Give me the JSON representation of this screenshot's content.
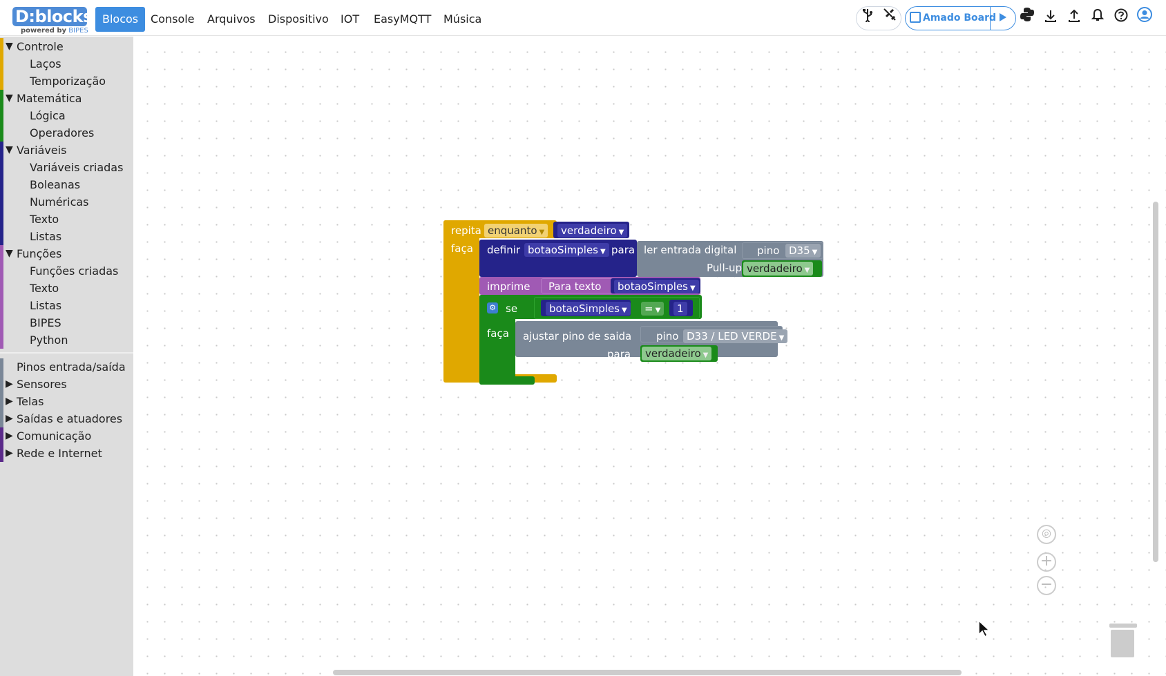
{
  "app": {
    "logo": "D:blocks",
    "logo_sub_prefix": "powered by",
    "logo_sub_brand": "BIPES"
  },
  "nav": {
    "tabs": [
      "Blocos",
      "Console",
      "Arquivos",
      "Dispositivo",
      "IOT",
      "EasyMQTT",
      "Música"
    ],
    "active": "Blocos"
  },
  "toolbar": {
    "board_label": "Amado Board",
    "icons": [
      "usb-icon",
      "disconnect-icon",
      "board-icon",
      "run-icon",
      "python-icon",
      "download-icon",
      "upload-icon",
      "bell-icon",
      "help-icon",
      "account-icon"
    ]
  },
  "sidebar": {
    "items": [
      {
        "label": "Controle",
        "level": 0,
        "arrow": "▼",
        "color": "#e0a800"
      },
      {
        "label": "Laços",
        "level": 1,
        "color": "#e0a800"
      },
      {
        "label": "Temporização",
        "level": 1,
        "color": "#e0a800"
      },
      {
        "label": "Matemática",
        "level": 0,
        "arrow": "▼",
        "color": "#1a8a1a"
      },
      {
        "label": "Lógica",
        "level": 1,
        "color": "#1a8a1a"
      },
      {
        "label": "Operadores",
        "level": 1,
        "color": "#1a8a1a"
      },
      {
        "label": "Variáveis",
        "level": 0,
        "arrow": "▼",
        "color": "#25238a"
      },
      {
        "label": "Variáveis criadas",
        "level": 1,
        "color": "#25238a"
      },
      {
        "label": "Boleanas",
        "level": 1,
        "color": "#25238a"
      },
      {
        "label": "Numéricas",
        "level": 1,
        "color": "#25238a"
      },
      {
        "label": "Texto",
        "level": 1,
        "color": "#25238a"
      },
      {
        "label": "Listas",
        "level": 1,
        "color": "#25238a"
      },
      {
        "label": "Funções",
        "level": 0,
        "arrow": "▼",
        "color": "#a05ab4"
      },
      {
        "label": "Funções criadas",
        "level": 1,
        "color": "#a05ab4"
      },
      {
        "label": "Texto",
        "level": 1,
        "color": "#a05ab4"
      },
      {
        "label": "Listas",
        "level": 1,
        "color": "#a05ab4"
      },
      {
        "label": "BIPES",
        "level": 1,
        "color": "#a05ab4"
      },
      {
        "label": "Python",
        "level": 1,
        "color": "#a05ab4"
      },
      {
        "label": "Pinos entrada/saída",
        "level": 0,
        "arrow": "",
        "color": "#7a8797"
      },
      {
        "label": "Sensores",
        "level": 0,
        "arrow": "▶",
        "color": "#7a8797"
      },
      {
        "label": "Telas",
        "level": 0,
        "arrow": "▶",
        "color": "#7a8797"
      },
      {
        "label": "Saídas e atuadores",
        "level": 0,
        "arrow": "▶",
        "color": "#7a8797"
      },
      {
        "label": "Comunicação",
        "level": 0,
        "arrow": "▶",
        "color": "#5b2a8a"
      },
      {
        "label": "Rede e Internet",
        "level": 0,
        "arrow": "▶",
        "color": "#5b2a8a"
      }
    ]
  },
  "blocks": {
    "repeat_kw": "repita",
    "repeat_mode": "enquanto",
    "repeat_cond": "verdadeiro",
    "repeat_do": "faça",
    "set_kw": "definir",
    "set_var": "botaoSimples",
    "set_to": "para",
    "digital_in": "ler entrada digital",
    "pin_kw": "pino",
    "pin_in": "D35",
    "pullup": "Pull-up",
    "pullup_val": "verdadeiro",
    "print_kw": "imprime",
    "to_text": "Para texto",
    "print_var": "botaoSimples",
    "if_kw": "se",
    "cmp_var": "botaoSimples",
    "cmp_op": "=",
    "cmp_num": "1",
    "if_do": "faça",
    "set_pin": "ajustar pino de saida",
    "pin_kw2": "pino",
    "pin_out": "D33 / LED VERDE",
    "pin_to": "para",
    "pin_out_val": "verdadeiro"
  },
  "colors": {
    "control": "#e0a800",
    "variables": "#25238a",
    "logic": "#1a8a1a",
    "text": "#a05ab4",
    "pins": "#7a8797",
    "boolean": "#8ec98e"
  }
}
